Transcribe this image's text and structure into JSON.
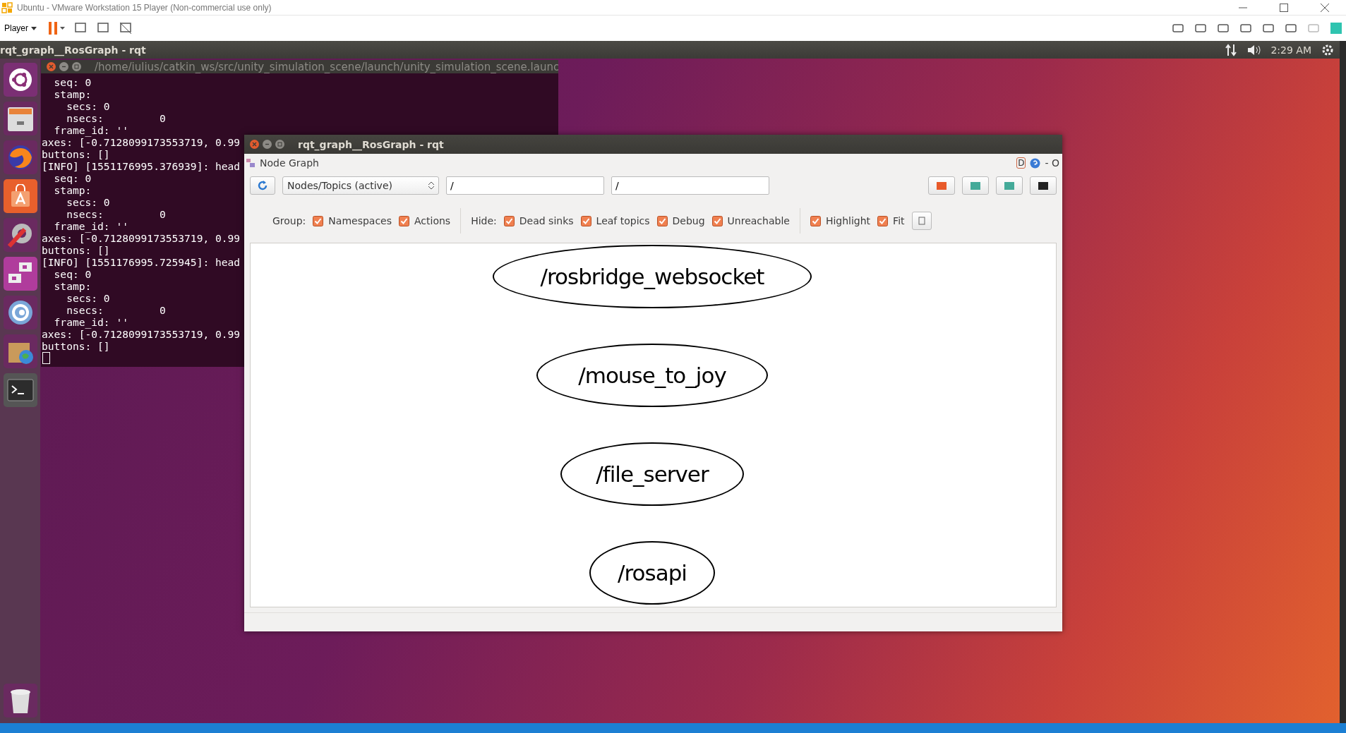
{
  "vmware": {
    "title": "Ubuntu - VMware Workstation 15 Player (Non-commercial use only)",
    "menu": "Player"
  },
  "top_bar": {
    "app_title": "rqt_graph__RosGraph - rqt",
    "clock": "2:29 AM"
  },
  "terminal": {
    "title": "/home/iulius/catkin_ws/src/unity_simulation_scene/launch/unity_simulation_scene.launc",
    "lines": [
      "  seq: 0",
      "  stamp:",
      "    secs: 0",
      "    nsecs:         0",
      "  frame_id: ''",
      "axes: [-0.7128099173553719, 0.99",
      "buttons: []",
      "[INFO] [1551176995.376939]: head",
      "  seq: 0",
      "  stamp:",
      "    secs: 0",
      "    nsecs:         0",
      "  frame_id: ''",
      "axes: [-0.7128099173553719, 0.99",
      "buttons: []",
      "[INFO] [1551176995.725945]: head",
      "  seq: 0",
      "  stamp:",
      "    secs: 0",
      "    nsecs:         0",
      "  frame_id: ''",
      "axes: [-0.7128099173553719, 0.99",
      "buttons: []"
    ]
  },
  "rqt": {
    "title": "rqt_graph__RosGraph - rqt",
    "plugin_title": "Node Graph",
    "help_letter": "D",
    "close_mark": "- O",
    "mode": "Nodes/Topics (active)",
    "filters": [
      {
        "value": "/"
      },
      {
        "value": "/"
      }
    ],
    "option_groups": [
      {
        "label": "Group:",
        "options": [
          {
            "label": "Namespaces",
            "checked": true
          },
          {
            "label": "Actions",
            "checked": true
          }
        ]
      },
      {
        "label": "Hide:",
        "options": [
          {
            "label": "Dead sinks",
            "checked": true
          },
          {
            "label": "Leaf topics",
            "checked": true
          },
          {
            "label": "Debug",
            "checked": true
          },
          {
            "label": "Unreachable",
            "checked": true
          }
        ]
      },
      {
        "options": [
          {
            "label": "Highlight",
            "checked": true
          },
          {
            "label": "Fit",
            "checked": true
          }
        ]
      }
    ],
    "nodes": [
      {
        "label": "/rosbridge_websocket"
      },
      {
        "label": "/mouse_to_joy"
      },
      {
        "label": "/file_server"
      },
      {
        "label": "/rosapi"
      }
    ]
  }
}
